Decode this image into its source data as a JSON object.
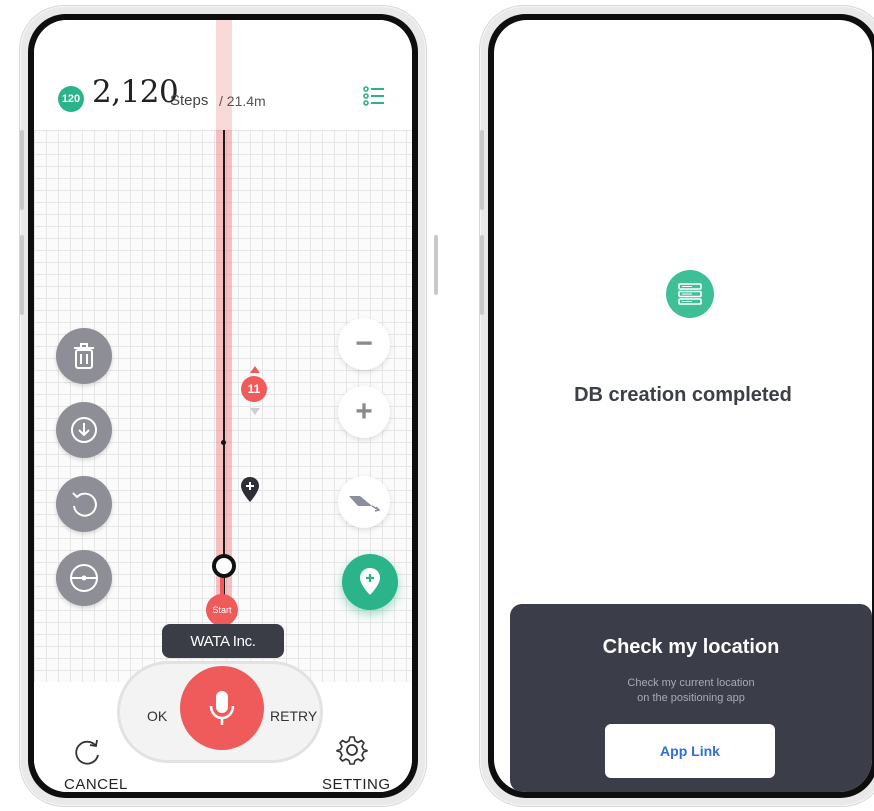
{
  "left_screen": {
    "header": {
      "step_badge": "120",
      "step_count": "2,120",
      "step_unit": "Steps",
      "distance": "/ 21.4m",
      "list_icon": "list-icon"
    },
    "map": {
      "marker_number": "11",
      "start_label": "Start",
      "company_label": "WATA Inc.",
      "side_buttons": [
        "trash-icon",
        "download-icon",
        "rotate-ccw-icon",
        "compass-icon"
      ],
      "zoom_out": "−",
      "zoom_in": "+",
      "add_pin_icon": "add-location-icon"
    },
    "voice": {
      "ok_label": "OK",
      "retry_label": "RETRY",
      "mic_icon": "microphone-icon"
    },
    "footer": {
      "cancel_label": "CANCEL",
      "setting_label": "SETTING"
    },
    "colors": {
      "accent_green": "#2bb389",
      "accent_red": "#ef5a5a",
      "dark_tag": "#3b3d46"
    }
  },
  "right_screen": {
    "db_icon": "database-icon",
    "db_title": "DB creation completed",
    "card": {
      "title": "Check my location",
      "description": "Check my current location\non the positioning app",
      "button_label": "App Link"
    },
    "colors": {
      "card_bg": "#3b3d48",
      "link_blue": "#2f6fd6"
    }
  }
}
